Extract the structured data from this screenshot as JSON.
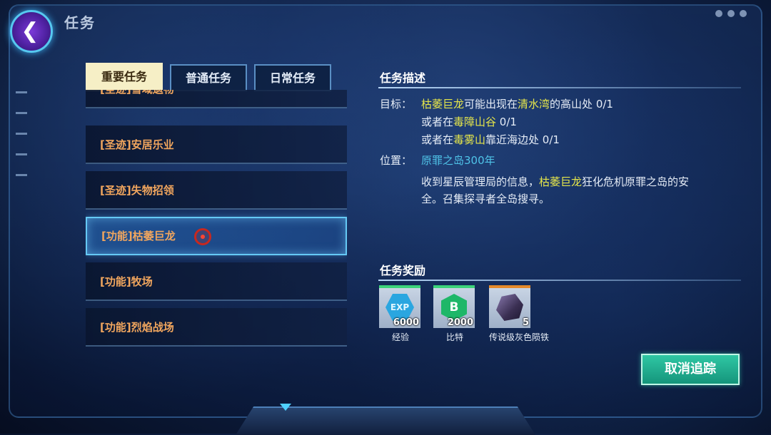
{
  "header": {
    "title": "任务"
  },
  "tabs": [
    {
      "label": "重要任务",
      "active": true
    },
    {
      "label": "普通任务",
      "active": false
    },
    {
      "label": "日常任务",
      "active": false
    }
  ],
  "quest_list": [
    {
      "label": "[圣迹]雪域遗物"
    },
    {
      "label": "[圣迹]安居乐业"
    },
    {
      "label": "[圣迹]失物招领"
    },
    {
      "label": "[功能]枯萎巨龙",
      "selected": true
    },
    {
      "label": "[功能]牧场"
    },
    {
      "label": "[功能]烈焰战场"
    }
  ],
  "description": {
    "title": "任务描述",
    "target_label": "目标：",
    "line1": {
      "hl1": "枯萎巨龙",
      "t1": "可能出现在",
      "hl2": "清水湾",
      "t2": "的高山处 0/1"
    },
    "line2": {
      "t1": "或者在",
      "hl": "毒障山谷",
      "t2": " 0/1"
    },
    "line3": {
      "t1": "或者在",
      "hl": "毒雾山",
      "t2": "靠近海边处 0/1"
    },
    "location_label": "位置：",
    "location": "原罪之岛300年",
    "body": {
      "t1": "收到星辰管理局的信息，",
      "hl": "枯萎巨龙",
      "t2": "狂化危机原罪之岛的安",
      "t3": "全。召集探寻者全岛搜寻。"
    }
  },
  "rewards": {
    "title": "任务奖励",
    "items": [
      {
        "icon": "exp-crystal-icon",
        "icon_text": "EXP",
        "count": "6000",
        "label": "经验"
      },
      {
        "icon": "bit-coin-icon",
        "icon_text": "B",
        "count": "2000",
        "label": "比特"
      },
      {
        "icon": "meteorite-ore-icon",
        "count": "5",
        "label": "传说级灰色陨铁"
      }
    ]
  },
  "cancel_button": "取消追踪",
  "colors": {
    "quest_text": "#f1a65e",
    "highlight": "#e6e64a",
    "location": "#4fc3e8",
    "active_tab": "#f6efc6",
    "cancel_button": "#1fae8e"
  }
}
